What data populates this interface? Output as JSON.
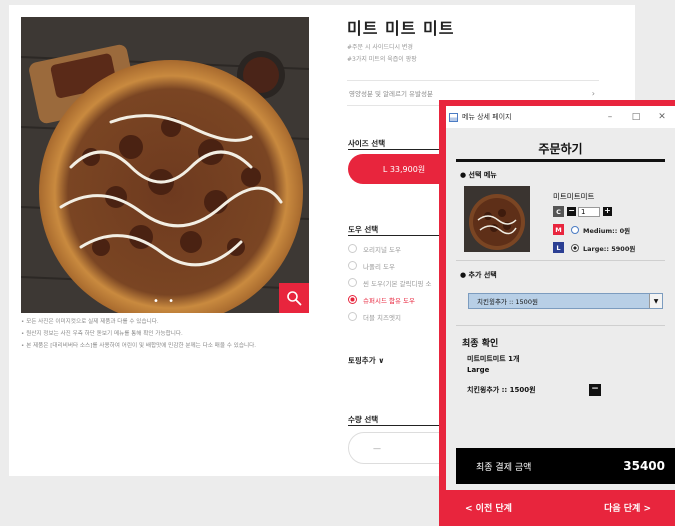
{
  "web": {
    "product_title": "미트 미트 미트",
    "product_desc": [
      "#주문 시 사이드디시 변경",
      "#3가지 미트의 육즙이 팡팡"
    ],
    "nutrition_label": "영양성분 및 알레르기 유발성분",
    "size_label": "사이즈 선택",
    "size_button": "L 33,900원",
    "dough_label": "도우 선택",
    "dough_options": [
      "오리지널 도우",
      "나폴리 도우",
      "씬 도우(기본 갈릭디핑 소",
      "슈퍼시드 함유 도우",
      "더블 치즈엣지"
    ],
    "dough_selected_index": 3,
    "topping_label": "토핑추가",
    "qty_label": "수량 선택",
    "qty_minus": "—",
    "notes": [
      "• 모든 사진은 이미지컷으로 실제 제품과 다를 수 있습니다.",
      "• 원산지 정보는 사진 우측 하단 돋보기 메뉴를 통해 확인 가능합니다.",
      "• 본 제품은 [대리비버타 소스]를 사용하여 어린이 및 배합맛에 민감한 분께는 다소 매울 수 있습니다."
    ],
    "photo_dots": "• •"
  },
  "window": {
    "title": "메뉴 상세 페이지",
    "controls": [
      "–",
      "□",
      "✕"
    ],
    "heading": "주문하기",
    "selected_menu_label": "● 선택 메뉴",
    "menu_name": "미트미트미트",
    "badge_c": "C",
    "badge_m": "M",
    "badge_l": "L",
    "stepper_minus": "−",
    "stepper_plus": "+",
    "quantity": "1",
    "size_medium": "Medium:: 0원",
    "size_large": "Large:: 5900원",
    "size_selected": "Large",
    "extra_label": "● 추가 선택",
    "topping_selected": "치킨윙추가 :: 1500원",
    "confirm_title": "최종 확인",
    "confirm_item": "미트미트미트  1개",
    "confirm_size": "Large",
    "confirm_extra": "치킨윙추가 :: 1500원",
    "remove_symbol": "−",
    "total_label": "최종 결제 금액",
    "total_value": "35400",
    "prev_button": "< 이전 단계",
    "next_button": "다음 단계 >"
  },
  "colors": {
    "accent_red": "#e8253d",
    "badge_gray": "#555555",
    "badge_blue": "#2b3f93",
    "select_blue": "#b8cfe6"
  },
  "icons": {
    "zoom": "magnifier-icon",
    "app": "java-app-icon",
    "chevron": "chevron-right-icon",
    "dropdown": "dropdown-arrow-icon"
  }
}
